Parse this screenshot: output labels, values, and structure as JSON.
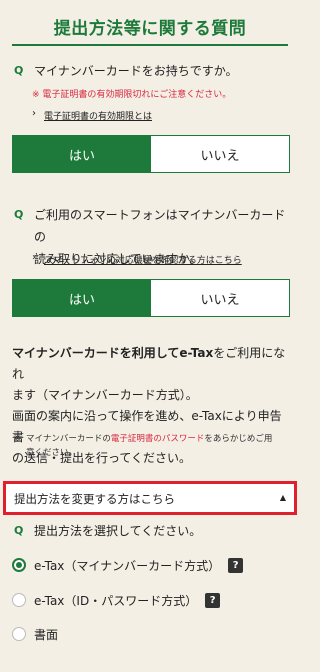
{
  "header": {
    "title": "提出方法等に関する質問"
  },
  "q_mark": "Q",
  "q1": {
    "text": "マイナンバーカードをお持ちですか。",
    "warning": "※ 電子証明書の有効期限切れにご注意ください。",
    "link": "電子証明書の有効期限とは",
    "yes": "はい",
    "no": "いいえ"
  },
  "q2": {
    "line1": "ご利用のスマートフォンはマイナンバーカードの",
    "line2": "読み取りに対応していますか。",
    "link": "スマートフォンの対応機種を確認する方はこちら",
    "yes": "はい",
    "no": "いいえ"
  },
  "info": {
    "bold": "マイナンバーカードを利用してe-Tax",
    "rest1": "をご利用になれ",
    "line2": "ます（マイナンバーカード方式）。",
    "line3": "画面の案内に沿って操作を進め、e-Taxにより申告書",
    "line4": "の送信・提出を行ってください。"
  },
  "note": {
    "mark": "※",
    "pre": "マイナンバーカードの",
    "red": "電子証明書のパスワード",
    "post": "をあらかじめご用",
    "line2": "意ください。"
  },
  "change": {
    "label": "提出方法を変更する方はこちら",
    "arrow": "▲"
  },
  "q3": {
    "text": "提出方法を選択してください。"
  },
  "options": [
    {
      "label": "e-Tax（マイナンバーカード方式）",
      "selected": true,
      "help": "?"
    },
    {
      "label": "e-Tax（ID・パスワード方式）",
      "selected": false,
      "help": "?"
    },
    {
      "label": "書面",
      "selected": false
    }
  ],
  "colors": {
    "accent": "#1d7a3b",
    "warning": "#d9283f",
    "highlight": "#e0202c",
    "background": "#f3efe5"
  }
}
